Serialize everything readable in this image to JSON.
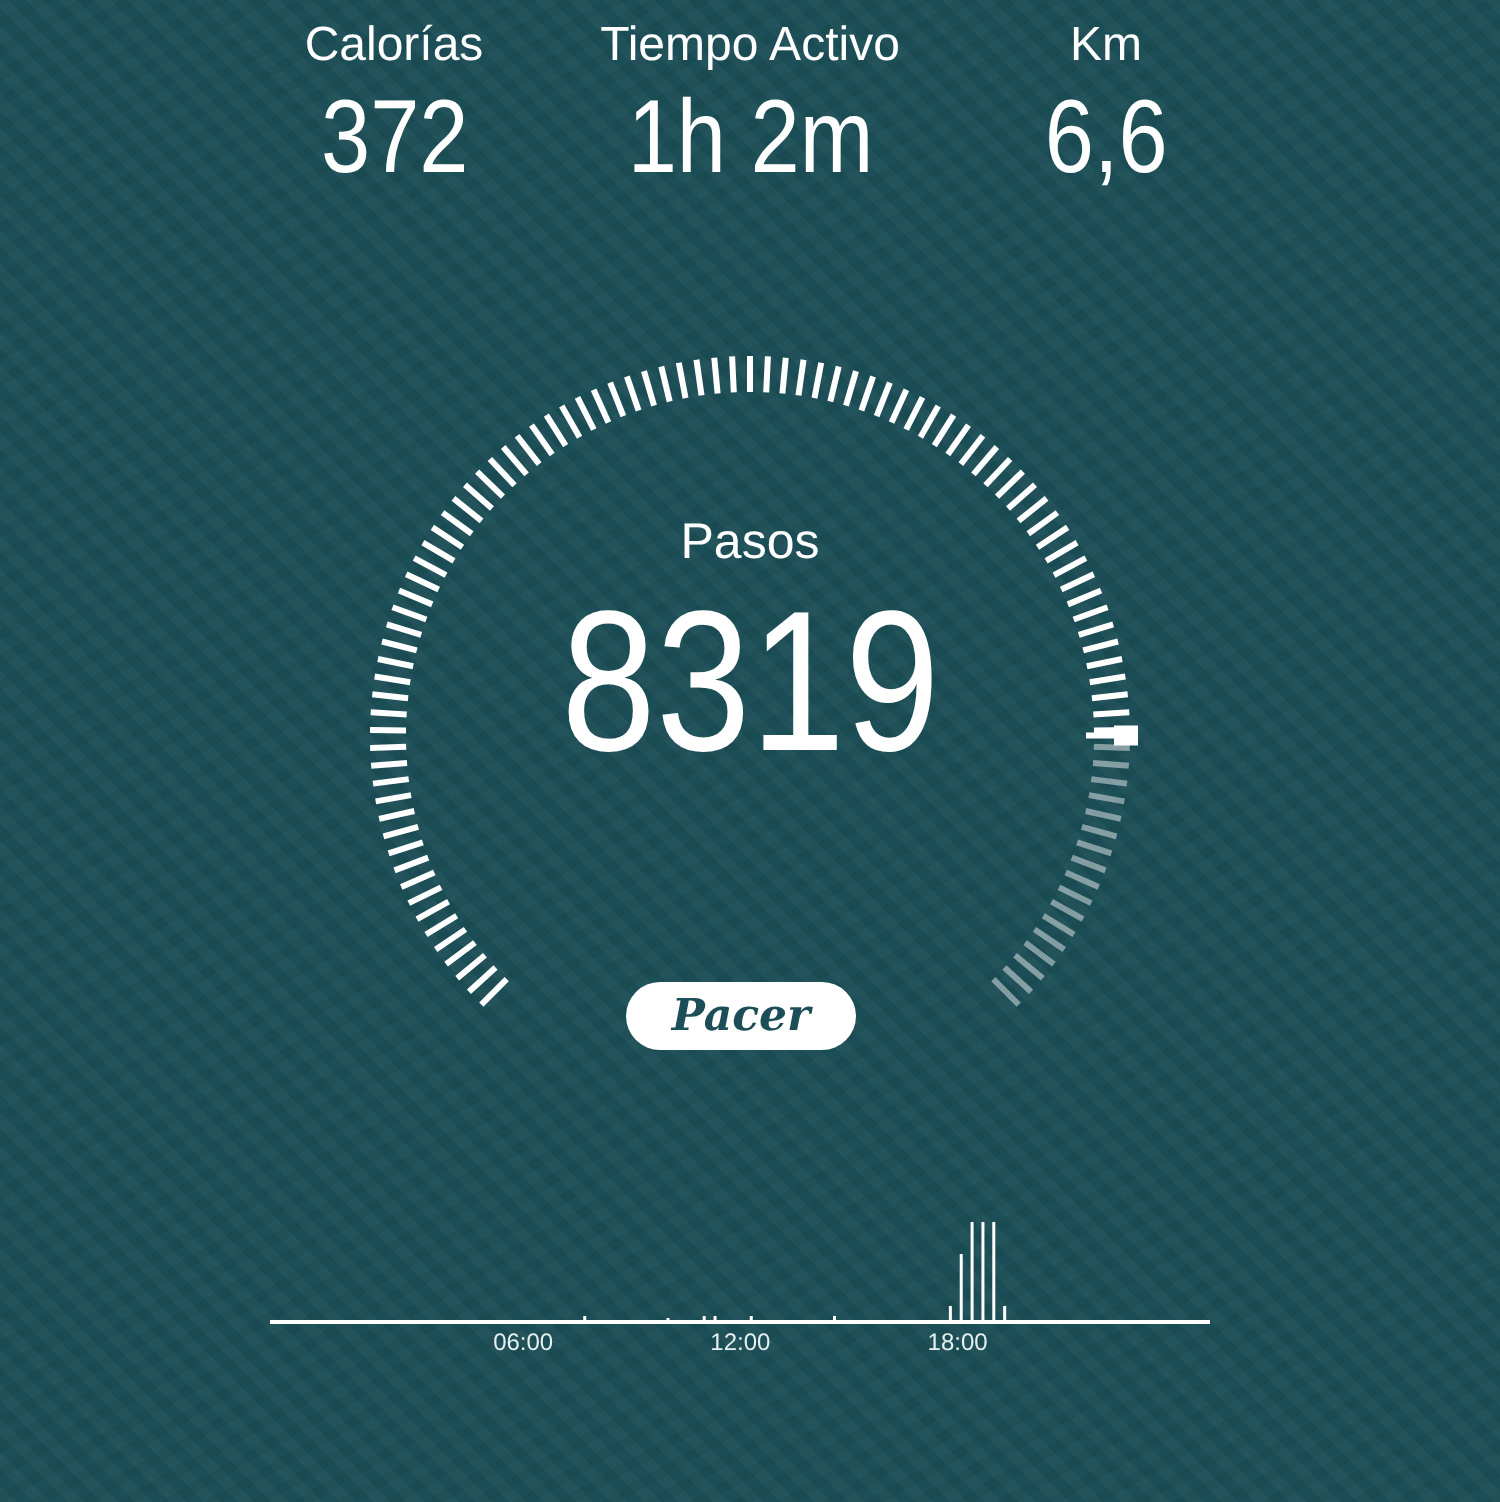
{
  "stats": [
    {
      "label": "Calorías",
      "value": "372"
    },
    {
      "label": "Tiempo Activo",
      "value": "1h 2m"
    },
    {
      "label": "Km",
      "value": "6,6"
    }
  ],
  "steps": {
    "label": "Pasos",
    "value": "8319"
  },
  "logo": "Pacer",
  "activity": {
    "time_labels": [
      "06:00",
      "12:00",
      "18:00"
    ]
  }
}
